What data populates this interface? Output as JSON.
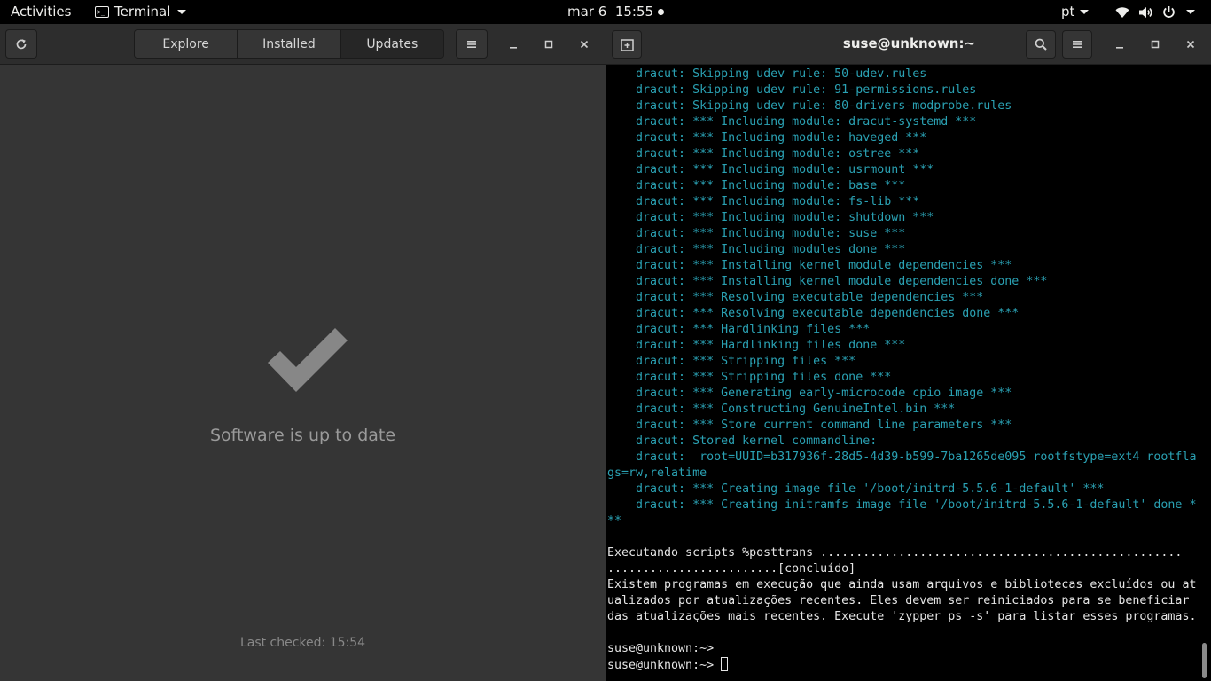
{
  "topbar": {
    "activities": "Activities",
    "app_name": "Terminal",
    "clock": "mar 6  15:55",
    "language": "pt",
    "icons": [
      "wifi-icon",
      "volume-icon",
      "power-icon"
    ]
  },
  "software": {
    "tabs": [
      {
        "label": "Explore",
        "active": false
      },
      {
        "label": "Installed",
        "active": false
      },
      {
        "label": "Updates",
        "active": true
      }
    ],
    "status": "Software is up to date",
    "last_checked": "Last checked: 15:54",
    "colors": {
      "icon": "#878787"
    }
  },
  "terminal": {
    "title": "suse@unknown:~",
    "lines": [
      {
        "text": "    dracut: Skipping udev rule: 50-udev.rules",
        "style": "dr"
      },
      {
        "text": "    dracut: Skipping udev rule: 91-permissions.rules",
        "style": "dr"
      },
      {
        "text": "    dracut: Skipping udev rule: 80-drivers-modprobe.rules",
        "style": "dr"
      },
      {
        "text": "    dracut: *** Including module: dracut-systemd ***",
        "style": "dr"
      },
      {
        "text": "    dracut: *** Including module: haveged ***",
        "style": "dr"
      },
      {
        "text": "    dracut: *** Including module: ostree ***",
        "style": "dr"
      },
      {
        "text": "    dracut: *** Including module: usrmount ***",
        "style": "dr"
      },
      {
        "text": "    dracut: *** Including module: base ***",
        "style": "dr"
      },
      {
        "text": "    dracut: *** Including module: fs-lib ***",
        "style": "dr"
      },
      {
        "text": "    dracut: *** Including module: shutdown ***",
        "style": "dr"
      },
      {
        "text": "    dracut: *** Including module: suse ***",
        "style": "dr"
      },
      {
        "text": "    dracut: *** Including modules done ***",
        "style": "dr"
      },
      {
        "text": "    dracut: *** Installing kernel module dependencies ***",
        "style": "dr"
      },
      {
        "text": "    dracut: *** Installing kernel module dependencies done ***",
        "style": "dr"
      },
      {
        "text": "    dracut: *** Resolving executable dependencies ***",
        "style": "dr"
      },
      {
        "text": "    dracut: *** Resolving executable dependencies done ***",
        "style": "dr"
      },
      {
        "text": "    dracut: *** Hardlinking files ***",
        "style": "dr"
      },
      {
        "text": "    dracut: *** Hardlinking files done ***",
        "style": "dr"
      },
      {
        "text": "    dracut: *** Stripping files ***",
        "style": "dr"
      },
      {
        "text": "    dracut: *** Stripping files done ***",
        "style": "dr"
      },
      {
        "text": "    dracut: *** Generating early-microcode cpio image ***",
        "style": "dr"
      },
      {
        "text": "    dracut: *** Constructing GenuineIntel.bin ***",
        "style": "dr"
      },
      {
        "text": "    dracut: *** Store current command line parameters ***",
        "style": "dr"
      },
      {
        "text": "    dracut: Stored kernel commandline:",
        "style": "dr"
      },
      {
        "text": "    dracut:  root=UUID=b317936f-28d5-4d39-b599-7ba1265de095 rootfstype=ext4 rootfla",
        "style": "dr"
      },
      {
        "text": "gs=rw,relatime",
        "style": "dr"
      },
      {
        "text": "    dracut: *** Creating image file '/boot/initrd-5.5.6-1-default' ***",
        "style": "dr"
      },
      {
        "text": "    dracut: *** Creating initramfs image file '/boot/initrd-5.5.6-1-default' done *",
        "style": "dr"
      },
      {
        "text": "**",
        "style": "dr"
      },
      {
        "text": "",
        "style": "plain"
      },
      {
        "text": "Executando scripts %posttrans ...................................................",
        "style": "plain"
      },
      {
        "text": "........................[concluído]",
        "style": "plain"
      },
      {
        "text": "Existem programas em execução que ainda usam arquivos e bibliotecas excluídos ou at",
        "style": "plain"
      },
      {
        "text": "ualizados por atualizações recentes. Eles devem ser reiniciados para se beneficiar",
        "style": "plain"
      },
      {
        "text": "das atualizações mais recentes. Execute 'zypper ps -s' para listar esses programas.",
        "style": "plain"
      },
      {
        "text": "",
        "style": "plain"
      },
      {
        "text": "suse@unknown:~> ",
        "style": "plain"
      },
      {
        "text": "suse@unknown:~> ",
        "style": "prompt"
      }
    ],
    "colors": {
      "dracut": "#2aa1b3",
      "text": "#e5e5e5",
      "background": "#000000"
    }
  }
}
